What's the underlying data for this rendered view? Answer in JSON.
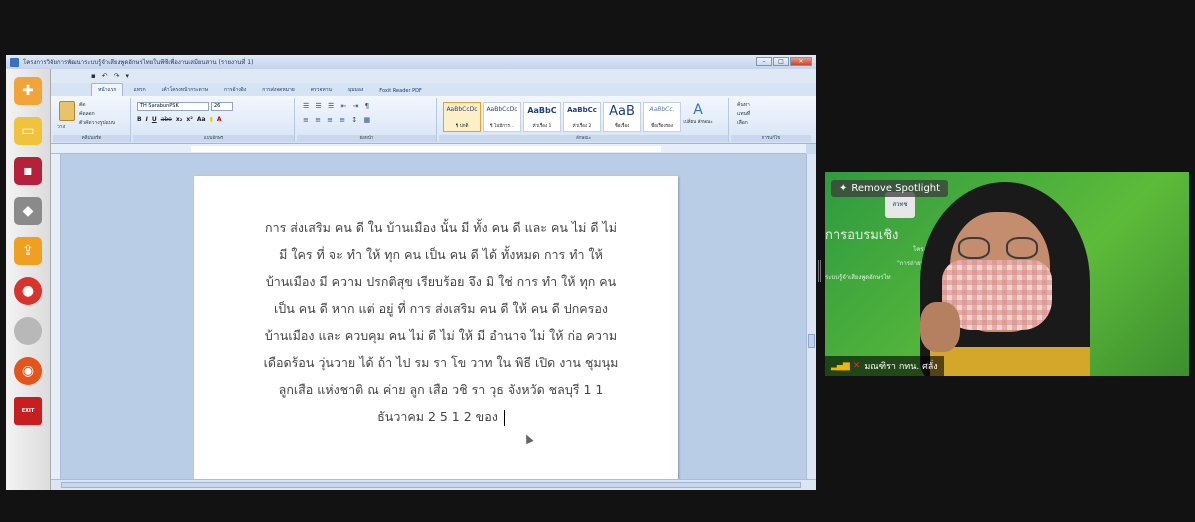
{
  "window": {
    "title": "โครงการวิจัยการพัฒนาระบบรู้จำเสียงพูดอักษรไทยในพีซีเพื่องานเสมียนสาน (รายงานที่ 1)"
  },
  "qat": {
    "undo": "↶",
    "redo": "↷",
    "more": "▾"
  },
  "ribbon": {
    "tabs": [
      "หน้าแรก",
      "แทรก",
      "เค้าโครงหน้ากระดาษ",
      "การอ้างอิง",
      "การส่งจดหมาย",
      "ตรวจทาน",
      "มุมมอง",
      "Foxit Reader PDF"
    ],
    "clipboard": {
      "paste": "วาง",
      "cut": "ตัด",
      "copy": "คัดลอก",
      "painter": "ตัวคัดวางรูปแบบ",
      "label": "คลิปบอร์ด"
    },
    "font": {
      "name": "TH SarabunPSK",
      "size": "26",
      "label": "แบบอักษร",
      "tools": [
        "B",
        "I",
        "U",
        "abe",
        "x₂",
        "x²",
        "Aa"
      ]
    },
    "paragraph": {
      "label": "ย่อหน้า"
    },
    "styles": {
      "label": "ลักษณะ",
      "items": [
        {
          "sample": "AaBbCcDc",
          "name": "¶ ปกติ"
        },
        {
          "sample": "AaBbCcDc",
          "name": "¶ ไม่มีการ..."
        },
        {
          "sample": "AaBbC",
          "name": "หัวเรื่อง 1"
        },
        {
          "sample": "AaBbCc",
          "name": "หัวเรื่อง 2"
        },
        {
          "sample": "AaB",
          "name": "ชื่อเรื่อง"
        },
        {
          "sample": "AaBbCc.",
          "name": "ชื่อเรื่องรอง"
        }
      ],
      "change": "เปลี่ยน ลักษณะ"
    },
    "editing": {
      "label": "การแก้ไข",
      "find": "ค้นหา",
      "replace": "แทนที่",
      "select": "เลือก"
    }
  },
  "document": {
    "lines": [
      "การ ส่งเสริม คน ดี ใน บ้านเมือง นั้น มี ทั้ง คน ดี และ คน ไม่ ดี ไม่",
      "มี ใคร ที่ จะ ทำ ให้ ทุก คน เป็น คน ดี ได้ ทั้งหมด การ ทำ ให้",
      "บ้านเมือง มี ความ ปรกติสุข เรียบร้อย จึง มิ ใช่ การ ทำ ให้ ทุก คน",
      "เป็น คน ดี หาก แต่ อยู่ ที่ การ ส่งเสริม คน ดี ให้ คน ดี ปกครอง",
      "บ้านเมือง และ ควบคุม คน ไม่ ดี ไม่ ให้ มี อำนาจ ไม่ ให้ ก่อ ความ",
      "เดือดร้อน วุ่นวาย ได้  ถ้า ไป รม รา โข วาท ใน พิธี เปิด งาน ชุมนุม",
      "ลูกเสือ แห่งชาติ ณ ค่าย ลูก เสือ วชิ รา วุธ จังหวัด ชลบุรี 1 1",
      "ธันวาคม 2 5 1 2 ของ"
    ]
  },
  "video": {
    "spotlight_label": "Remove Spotlight",
    "participant_name": "มณฑิรา กทน. ศลั่ง",
    "bg_title": "การอบรมเชิง",
    "bg_line1": "โครงก",
    "bg_line2": "\"การถ่ายทอดเ",
    "bg_line3": "ระบบรู้จำเสียงพูดอักษรไท",
    "logo_text": "สวทช"
  },
  "sidebar": {
    "exit_label": "EXIT"
  }
}
